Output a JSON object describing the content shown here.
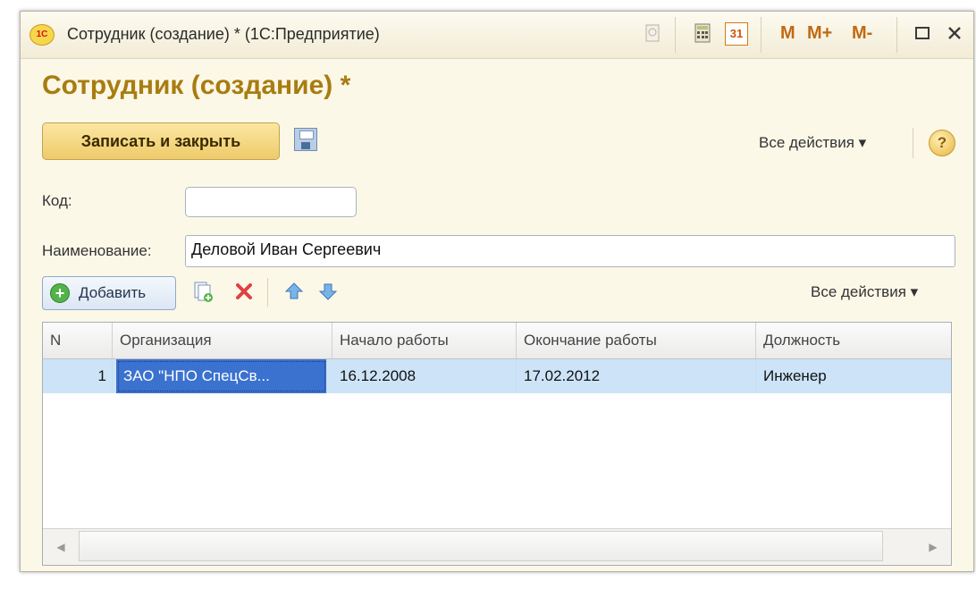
{
  "window": {
    "logo_text": "1С",
    "title": "Сотрудник (создание) * (1С:Предприятие)",
    "toolbar_icons": [
      "history-icon",
      "calculator-icon",
      "calendar-icon"
    ],
    "calendar_day": "31",
    "memory_buttons": [
      "M",
      "M+",
      "M-"
    ]
  },
  "form": {
    "title": "Сотрудник (создание) *",
    "save_close_label": "Записать и закрыть",
    "all_actions": "Все действия ▾",
    "help": "?"
  },
  "fields": {
    "code_label": "Код:",
    "code_value": "",
    "name_label": "Наименование:",
    "name_value": "Деловой Иван Сергеевич"
  },
  "table_toolbar": {
    "add_label": "Добавить",
    "all_actions": "Все действия ▾"
  },
  "table": {
    "columns": [
      "N",
      "Организация",
      "Начало работы",
      "Окончание работы",
      "Должность"
    ],
    "rows": [
      [
        "1",
        "ЗАО \"НПО СпецСв...",
        "16.12.2008",
        "17.02.2012",
        "Инженер"
      ]
    ]
  },
  "colors": {
    "accent_title": "#a87c10",
    "selection": "#cde4f8",
    "selected_cell": "#3b72cf"
  }
}
